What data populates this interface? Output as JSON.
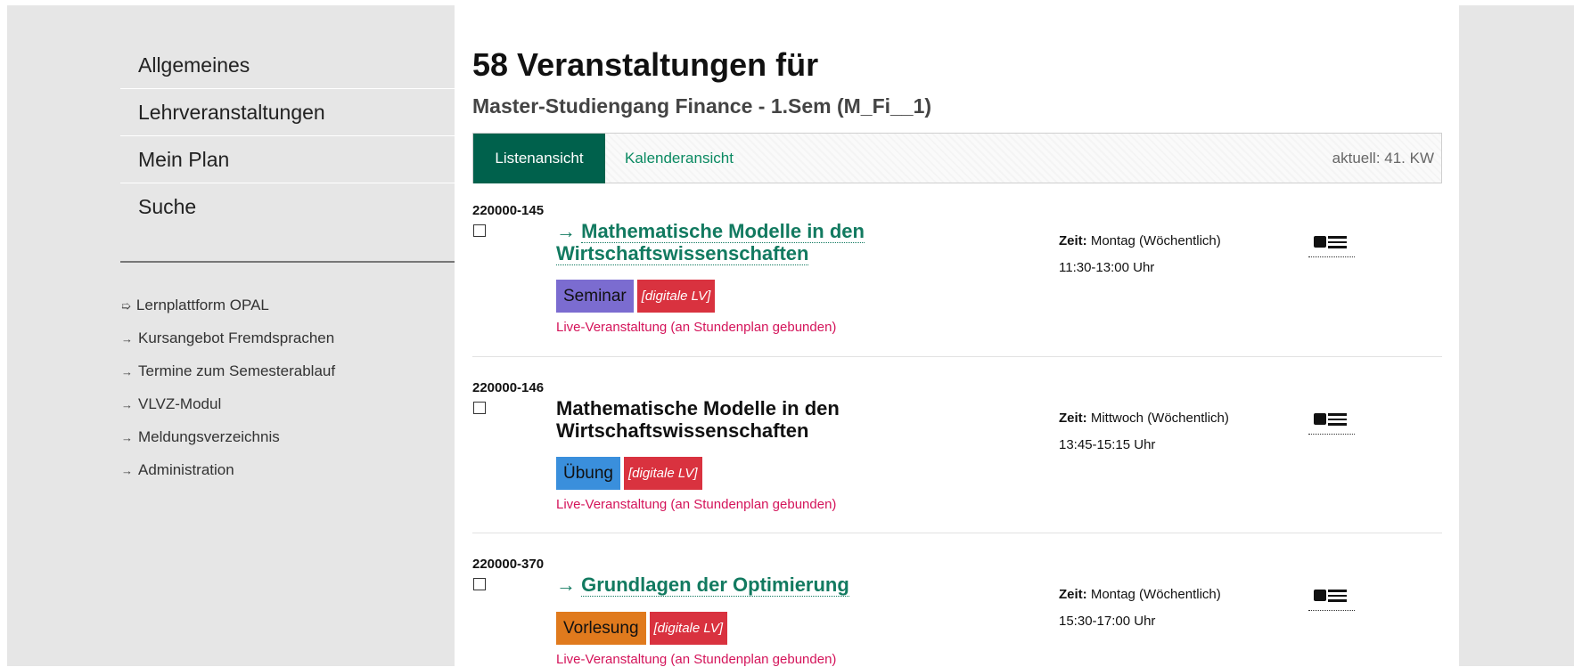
{
  "sidebar": {
    "nav": [
      "Allgemeines",
      "Lehrveranstaltungen",
      "Mein Plan",
      "Suche"
    ],
    "links": [
      {
        "arrow": "➯",
        "label": "Lernplattform OPAL"
      },
      {
        "arrow": "→",
        "label": "Kursangebot Fremdsprachen"
      },
      {
        "arrow": "→",
        "label": "Termine zum Semesterablauf"
      },
      {
        "arrow": "→",
        "label": "VLVZ-Modul"
      },
      {
        "arrow": "→",
        "label": "Meldungsverzeichnis"
      },
      {
        "arrow": "→",
        "label": "Administration"
      }
    ]
  },
  "main": {
    "title": "58 Veranstaltungen für",
    "subtitle": "Master-Studiengang Finance - 1.Sem (M_Fi__1)",
    "tabs": {
      "active": "Listenansicht",
      "other": "Kalenderansicht",
      "current": "aktuell: 41. KW"
    },
    "courses": [
      {
        "id": "220000-145",
        "link_arrow": "→",
        "title_lines": [
          "Mathematische Modelle in den",
          "Wirtschaftswissenschaften"
        ],
        "badge": "Seminar",
        "badge_color": "#7b6cd0",
        "digital": "[digitale LV]",
        "live": "Live-Veranstaltung (an Stundenplan gebunden)",
        "zeit_label": "Zeit:",
        "zeit_day": "Montag (Wöchentlich)",
        "zeit_time": "11:30-13:00 Uhr"
      },
      {
        "id": "220000-146",
        "link_arrow": "",
        "title_lines": [
          "Mathematische Modelle in den",
          "Wirtschaftswissenschaften"
        ],
        "badge": "Übung",
        "badge_color": "#3a8fdc",
        "digital": "[digitale LV]",
        "live": "Live-Veranstaltung (an Stundenplan gebunden)",
        "zeit_label": "Zeit:",
        "zeit_day": "Mittwoch (Wöchentlich)",
        "zeit_time": "13:45-15:15 Uhr"
      },
      {
        "id": "220000-370",
        "link_arrow": "→",
        "title_lines": [
          "Grundlagen der Optimierung"
        ],
        "badge": "Vorlesung",
        "badge_color": "#e07a1d",
        "digital": "[digitale LV]",
        "live": "Live-Veranstaltung (an Stundenplan gebunden)",
        "zeit_label": "Zeit:",
        "zeit_day": "Montag (Wöchentlich)",
        "zeit_time": "15:30-17:00 Uhr"
      }
    ]
  }
}
